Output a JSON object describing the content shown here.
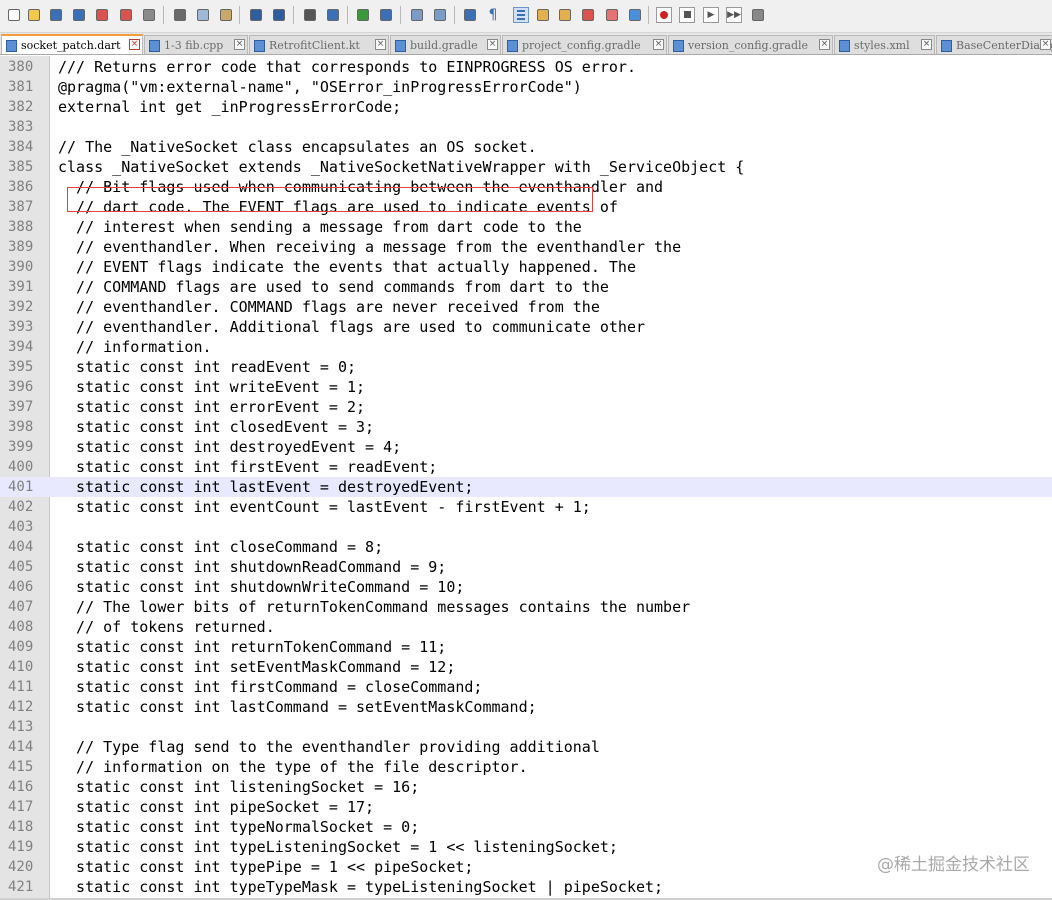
{
  "toolbar": {
    "buttons": [
      "new-icon",
      "open-icon",
      "save-icon",
      "save-all-icon",
      "close-icon",
      "close-all-icon",
      "print-icon",
      "cut-icon",
      "copy-icon",
      "paste-icon",
      "undo-icon",
      "redo-icon",
      "find-icon",
      "replace-icon",
      "zoom-in-icon",
      "zoom-out-icon",
      "sync-vertical-icon",
      "sync-horizontal-icon",
      "word-wrap-icon",
      "show-all-chars-icon",
      "indent-guide-icon",
      "udl-icon",
      "doc-map-icon",
      "function-list-icon",
      "folder-workspace-icon",
      "monitoring-icon",
      "record-macro-icon",
      "stop-macro-icon",
      "play-macro-icon",
      "run-macro-multiple-icon",
      "save-macro-icon"
    ]
  },
  "tabs": [
    {
      "label": "socket_patch.dart",
      "active": true
    },
    {
      "label": "1-3 fib.cpp",
      "active": false
    },
    {
      "label": "RetrofitClient.kt",
      "active": false
    },
    {
      "label": "build.gradle",
      "active": false
    },
    {
      "label": "project_config.gradle",
      "active": false
    },
    {
      "label": "version_config.gradle",
      "active": false
    },
    {
      "label": "styles.xml",
      "active": false
    },
    {
      "label": "BaseCenterDialog",
      "active": false
    }
  ],
  "editor": {
    "current_line": 401,
    "lines": [
      {
        "n": "380",
        "text": "/// Returns error code that corresponds to EINPROGRESS OS error."
      },
      {
        "n": "381",
        "text": "@pragma(\"vm:external-name\", \"OSError_inProgressErrorCode\")"
      },
      {
        "n": "382",
        "text": "external int get _inProgressErrorCode;"
      },
      {
        "n": "383",
        "text": ""
      },
      {
        "n": "384",
        "text": "// The _NativeSocket class encapsulates an OS socket."
      },
      {
        "n": "385",
        "text": "class _NativeSocket extends _NativeSocketNativeWrapper with _ServiceObject {"
      },
      {
        "n": "386",
        "text": "  // Bit flags used when communicating between the eventhandler and"
      },
      {
        "n": "387",
        "text": "  // dart code. The EVENT flags are used to indicate events of"
      },
      {
        "n": "388",
        "text": "  // interest when sending a message from dart code to the"
      },
      {
        "n": "389",
        "text": "  // eventhandler. When receiving a message from the eventhandler the"
      },
      {
        "n": "390",
        "text": "  // EVENT flags indicate the events that actually happened. The"
      },
      {
        "n": "391",
        "text": "  // COMMAND flags are used to send commands from dart to the"
      },
      {
        "n": "392",
        "text": "  // eventhandler. COMMAND flags are never received from the"
      },
      {
        "n": "393",
        "text": "  // eventhandler. Additional flags are used to communicate other"
      },
      {
        "n": "394",
        "text": "  // information."
      },
      {
        "n": "395",
        "text": "  static const int readEvent = 0;"
      },
      {
        "n": "396",
        "text": "  static const int writeEvent = 1;"
      },
      {
        "n": "397",
        "text": "  static const int errorEvent = 2;"
      },
      {
        "n": "398",
        "text": "  static const int closedEvent = 3;"
      },
      {
        "n": "399",
        "text": "  static const int destroyedEvent = 4;"
      },
      {
        "n": "400",
        "text": "  static const int firstEvent = readEvent;"
      },
      {
        "n": "401",
        "text": "  static const int lastEvent = destroyedEvent;"
      },
      {
        "n": "402",
        "text": "  static const int eventCount = lastEvent - firstEvent + 1;"
      },
      {
        "n": "403",
        "text": ""
      },
      {
        "n": "404",
        "text": "  static const int closeCommand = 8;"
      },
      {
        "n": "405",
        "text": "  static const int shutdownReadCommand = 9;"
      },
      {
        "n": "406",
        "text": "  static const int shutdownWriteCommand = 10;"
      },
      {
        "n": "407",
        "text": "  // The lower bits of returnTokenCommand messages contains the number"
      },
      {
        "n": "408",
        "text": "  // of tokens returned."
      },
      {
        "n": "409",
        "text": "  static const int returnTokenCommand = 11;"
      },
      {
        "n": "410",
        "text": "  static const int setEventMaskCommand = 12;"
      },
      {
        "n": "411",
        "text": "  static const int firstCommand = closeCommand;"
      },
      {
        "n": "412",
        "text": "  static const int lastCommand = setEventMaskCommand;"
      },
      {
        "n": "413",
        "text": ""
      },
      {
        "n": "414",
        "text": "  // Type flag send to the eventhandler providing additional"
      },
      {
        "n": "415",
        "text": "  // information on the type of the file descriptor."
      },
      {
        "n": "416",
        "text": "  static const int listeningSocket = 16;"
      },
      {
        "n": "417",
        "text": "  static const int pipeSocket = 17;"
      },
      {
        "n": "418",
        "text": "  static const int typeNormalSocket = 0;"
      },
      {
        "n": "419",
        "text": "  static const int typeListeningSocket = 1 << listeningSocket;"
      },
      {
        "n": "420",
        "text": "  static const int typePipe = 1 << pipeSocket;"
      },
      {
        "n": "421",
        "text": "  static const int typeTypeMask = typeListeningSocket | pipeSocket;"
      }
    ]
  },
  "watermark": "@稀土掘金技术社区",
  "colors": {
    "current_line_bg": "#e8e8ff",
    "highlight_box": "#e04040",
    "active_tab_accent": "#f39c3c"
  }
}
